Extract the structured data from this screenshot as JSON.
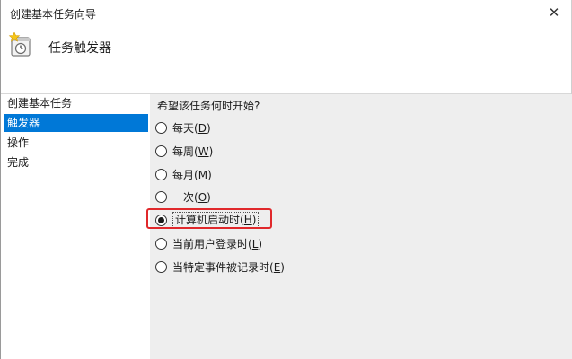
{
  "window": {
    "title": "创建基本任务向导",
    "close_glyph": "✕"
  },
  "header": {
    "heading": "任务触发器",
    "icon": "task-clock-icon"
  },
  "sidebar": {
    "items": [
      {
        "label": "创建基本任务",
        "active": false
      },
      {
        "label": "触发器",
        "active": true
      },
      {
        "label": "操作",
        "active": false
      },
      {
        "label": "完成",
        "active": false
      }
    ],
    "active_color": "#0078d7"
  },
  "main": {
    "question": "希望该任务何时开始?",
    "options": [
      {
        "label": "每天",
        "key": "D",
        "selected": false
      },
      {
        "label": "每周",
        "key": "W",
        "selected": false
      },
      {
        "label": "每月",
        "key": "M",
        "selected": false
      },
      {
        "label": "一次",
        "key": "O",
        "selected": false
      },
      {
        "label": "计算机启动时",
        "key": "H",
        "selected": true
      },
      {
        "label": "当前用户登录时",
        "key": "L",
        "selected": false
      },
      {
        "label": "当特定事件被记录时",
        "key": "E",
        "selected": false
      }
    ]
  },
  "annotation": {
    "highlight_color": "#e0282b"
  }
}
